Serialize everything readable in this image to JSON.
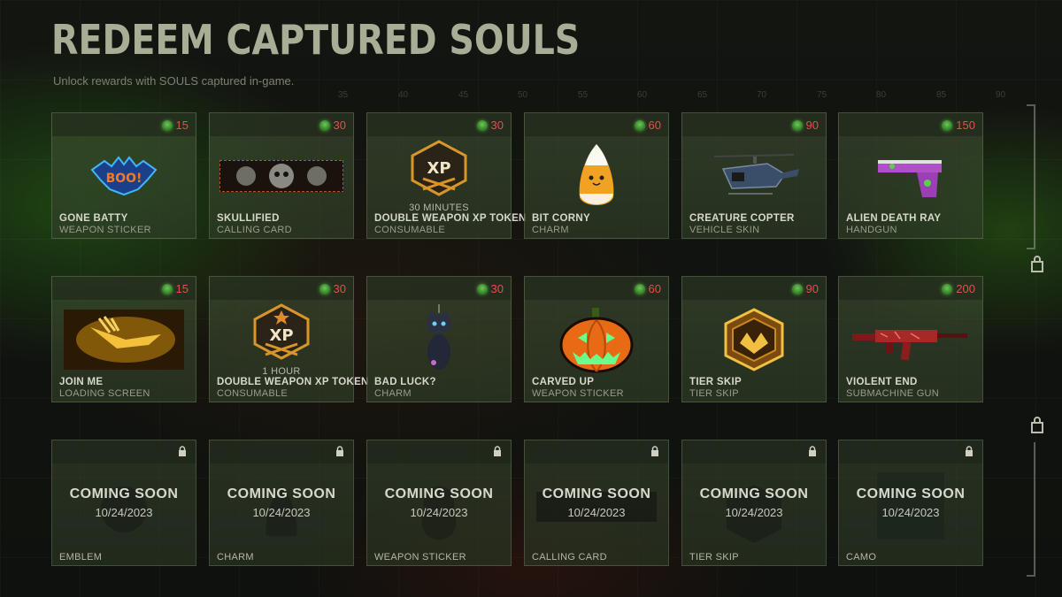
{
  "header": {
    "title": "REDEEM CAPTURED SOULS",
    "subtitle": "Unlock rewards with SOULS captured in-game."
  },
  "currency_icon": "soul-icon",
  "rewards": [
    {
      "name": "GONE BATTY",
      "type": "WEAPON STICKER",
      "cost": "15",
      "art": "boo-bat-sticker"
    },
    {
      "name": "SKULLIFIED",
      "type": "CALLING CARD",
      "cost": "30",
      "art": "skull-calling-card"
    },
    {
      "name": "DOUBLE WEAPON XP TOKEN",
      "type": "CONSUMABLE",
      "cost": "30",
      "note": "30 MINUTES",
      "art": "xp-token"
    },
    {
      "name": "BIT CORNY",
      "type": "CHARM",
      "cost": "60",
      "art": "candy-corn-charm"
    },
    {
      "name": "CREATURE COPTER",
      "type": "VEHICLE SKIN",
      "cost": "90",
      "art": "helicopter"
    },
    {
      "name": "ALIEN DEATH RAY",
      "type": "HANDGUN",
      "cost": "150",
      "art": "handgun"
    },
    {
      "name": "JOIN ME",
      "type": "LOADING SCREEN",
      "cost": "15",
      "art": "loading-screen"
    },
    {
      "name": "DOUBLE WEAPON XP TOKEN",
      "type": "CONSUMABLE",
      "cost": "30",
      "note": "1 HOUR",
      "art": "xp-token-star"
    },
    {
      "name": "BAD LUCK?",
      "type": "CHARM",
      "cost": "30",
      "art": "black-cat-charm"
    },
    {
      "name": "CARVED UP",
      "type": "WEAPON STICKER",
      "cost": "60",
      "art": "pumpkin-sticker"
    },
    {
      "name": "TIER SKIP",
      "type": "TIER SKIP",
      "cost": "90",
      "art": "tier-skip-badge"
    },
    {
      "name": "VIOLENT END",
      "type": "SUBMACHINE GUN",
      "cost": "200",
      "art": "smg"
    }
  ],
  "coming_soon": [
    {
      "label": "COMING SOON",
      "date": "10/24/2023",
      "type": "EMBLEM"
    },
    {
      "label": "COMING SOON",
      "date": "10/24/2023",
      "type": "CHARM"
    },
    {
      "label": "COMING SOON",
      "date": "10/24/2023",
      "type": "WEAPON STICKER"
    },
    {
      "label": "COMING SOON",
      "date": "10/24/2023",
      "type": "CALLING CARD"
    },
    {
      "label": "COMING SOON",
      "date": "10/24/2023",
      "type": "TIER SKIP"
    },
    {
      "label": "COMING SOON",
      "date": "10/24/2023",
      "type": "CAMO"
    }
  ],
  "colors": {
    "title": "#a8ad95",
    "cost": "#e0524a",
    "soul": "#6ec85a",
    "card": "#46583a"
  }
}
